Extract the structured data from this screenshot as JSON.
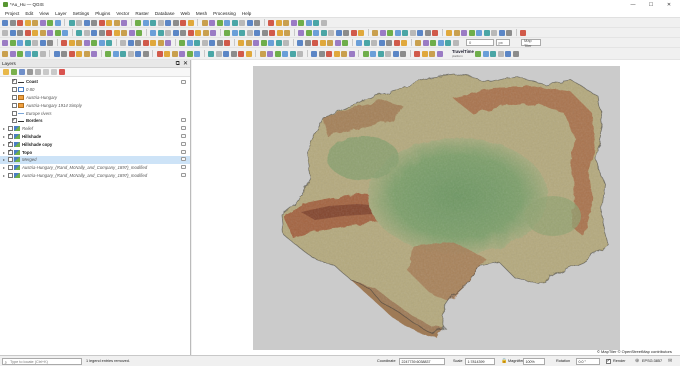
{
  "window": {
    "title": "*Au_Hu — QGIS",
    "controls": [
      "—",
      "☐",
      "✕"
    ]
  },
  "menu": [
    "Project",
    "Edit",
    "View",
    "Layer",
    "Settings",
    "Plugins",
    "Vector",
    "Raster",
    "Database",
    "Web",
    "Mesh",
    "Processing",
    "Help"
  ],
  "toolbar": {
    "scale_value": "0",
    "unit_value": "px",
    "search_placeholder": "Map Tiler",
    "traveltime_label": "TravelTime",
    "traveltime_sub": "platform"
  },
  "layers_panel": {
    "title": "Layers",
    "header_buttons": [
      "⧉",
      "✕"
    ],
    "layers": [
      {
        "label": "Coast",
        "checked": true,
        "style": "bold",
        "symbol": "line",
        "expander": "",
        "indent": 1
      },
      {
        "label": "0 80",
        "checked": false,
        "style": "italic",
        "symbol": "square-outline",
        "expander": "",
        "indent": 1
      },
      {
        "label": "Austria-Hungary",
        "checked": false,
        "style": "italic",
        "symbol": "fill-orange",
        "expander": "",
        "indent": 1
      },
      {
        "label": "Austria-Hungary 1914 Simply",
        "checked": false,
        "style": "italic",
        "symbol": "fill-orange",
        "expander": "",
        "indent": 1
      },
      {
        "label": "Europe rivers",
        "checked": false,
        "style": "italic",
        "symbol": "line-light",
        "expander": "",
        "indent": 1
      },
      {
        "label": "Borders",
        "checked": true,
        "style": "bold",
        "symbol": "line",
        "expander": "",
        "indent": 1
      },
      {
        "label": "Relief",
        "checked": false,
        "style": "italic",
        "symbol": "raster",
        "expander": "▸",
        "indent": 0
      },
      {
        "label": "Hillshade",
        "checked": true,
        "style": "bold",
        "symbol": "raster",
        "expander": "▸",
        "indent": 0
      },
      {
        "label": "Hillshade copy",
        "checked": true,
        "style": "bold",
        "symbol": "raster",
        "expander": "▸",
        "indent": 0
      },
      {
        "label": "Topo",
        "checked": true,
        "style": "bold",
        "symbol": "raster",
        "expander": "▸",
        "indent": 0
      },
      {
        "label": "Merged",
        "checked": false,
        "style": "italic",
        "symbol": "raster",
        "expander": "▸",
        "indent": 0,
        "selected": true
      },
      {
        "label": "Austria-Hungary_(Rand_McNally_and_Company_1897)_modified",
        "checked": false,
        "style": "italic",
        "symbol": "raster",
        "expander": "▸",
        "indent": 0
      },
      {
        "label": "Austria-Hungary_(Rand_McNally_and_Company_1897)_modified",
        "checked": false,
        "style": "italic",
        "symbol": "raster",
        "expander": "▸",
        "indent": 0
      }
    ]
  },
  "map": {
    "attribution": "© MapTiler  © OpenStreetMap contributors"
  },
  "statusbar": {
    "locator_placeholder": "Type to locate (Ctrl+K)",
    "message": "1 legend entries removed.",
    "coordinate_label": "Coordinate",
    "coordinate_value": "2247739.6038837",
    "scale_label": "Scale",
    "scale_value": "1:7814399",
    "magnifier_label": "Magnifier",
    "magnifier_value": "100%",
    "rotation_label": "Rotation",
    "rotation_value": "0.0 °",
    "render_label": "Render",
    "crs_label": "EPSG:3857"
  },
  "colors": {
    "lowland": "#6e9662",
    "hill": "#b9ad82",
    "mountain": "#a8623e",
    "background": "#cbcbcb",
    "qgis_green": "#589632",
    "selection": "#cde3f7"
  }
}
